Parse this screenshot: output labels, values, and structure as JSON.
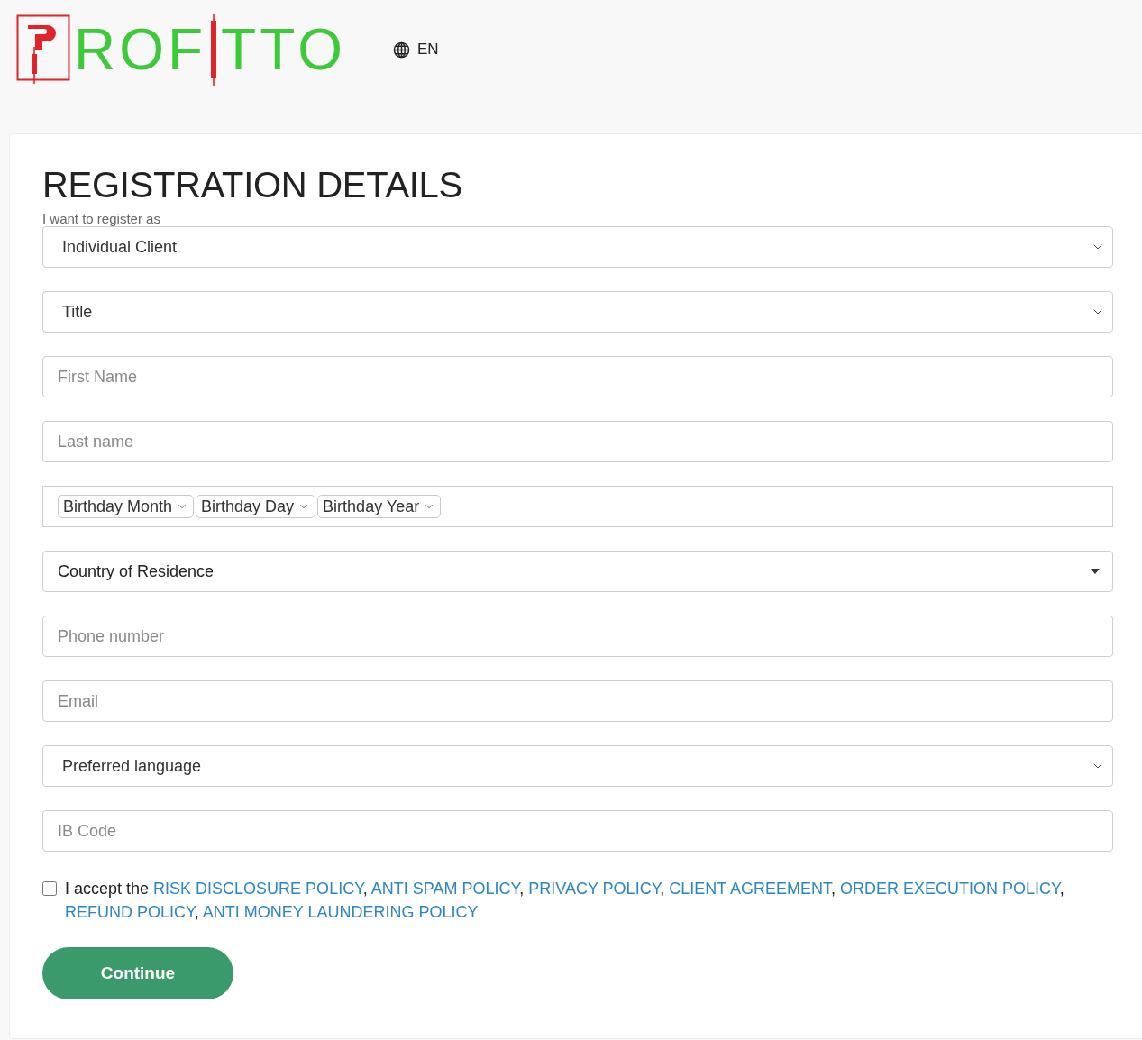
{
  "header": {
    "logo": {
      "part_1": "ROF",
      "part_2": "TTO"
    },
    "language": "EN"
  },
  "form": {
    "title": "REGISTRATION DETAILS",
    "fields": [
      {
        "kind": "select",
        "label": "I want to register as",
        "value": "Individual Client"
      },
      {
        "kind": "select",
        "value": "Title"
      },
      {
        "kind": "input",
        "placeholder": "First Name"
      },
      {
        "kind": "input",
        "placeholder": "Last name"
      },
      {
        "kind": "date",
        "parts": [
          "Birthday Month",
          "Birthday Day",
          "Birthday Year"
        ]
      },
      {
        "kind": "combo",
        "value": "Country of Residence"
      },
      {
        "kind": "input",
        "placeholder": "Phone number"
      },
      {
        "kind": "input",
        "placeholder": "Email"
      },
      {
        "kind": "select",
        "value": "Preferred language"
      },
      {
        "kind": "input",
        "placeholder": "IB Code"
      }
    ],
    "consent": {
      "checked": false,
      "prefix": "I accept the",
      "separator": ",",
      "links": [
        "RISK DISCLOSURE POLICY",
        "ANTI SPAM POLICY",
        "PRIVACY POLICY",
        "CLIENT AGREEMENT",
        "ORDER EXECUTION POLICY",
        "REFUND POLICY",
        "ANTI MONEY LAUNDERING POLICY"
      ]
    },
    "submit": "Continue"
  }
}
